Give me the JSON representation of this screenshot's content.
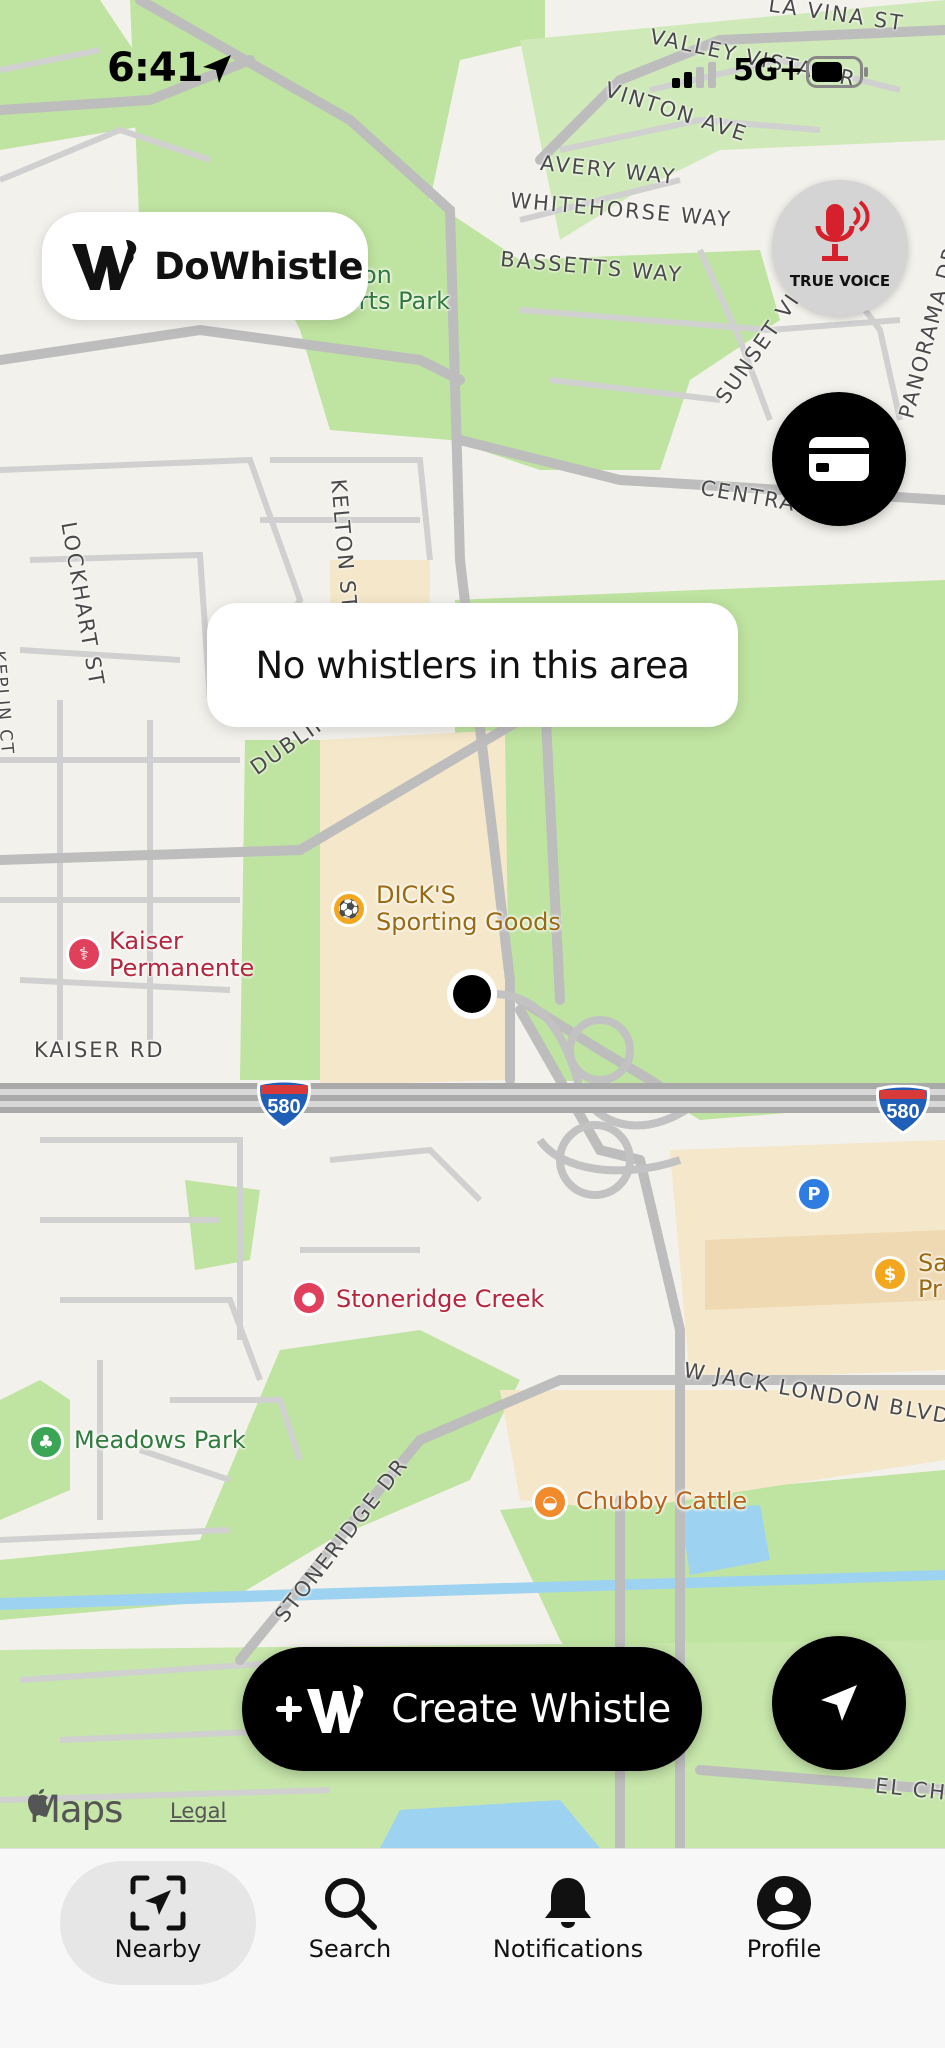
{
  "status_bar": {
    "time": "6:41",
    "network": "5G+"
  },
  "brand": {
    "name": "DoWhistle"
  },
  "true_voice": {
    "label": "TRUE VOICE"
  },
  "banner": {
    "message": "No whistlers in this area"
  },
  "create_button": {
    "label": "Create Whistle"
  },
  "map": {
    "attribution": "Maps",
    "legal": "Legal",
    "road_labels": {
      "la_vina": "LA VINA ST",
      "valley_vista": "VALLEY VISTA DR",
      "vinton": "VINTON AVE",
      "avery": "AVERY WAY",
      "whitehorse": "WHITEHORSE WAY",
      "bassetts": "BASSETTS WAY",
      "sunset": "SUNSET VIE",
      "panorama": "PANORAMA DR",
      "central": "CENTRAL",
      "lockhart": "LOCKHART ST",
      "kelton": "KELTON ST",
      "dublin": "DUBLIN BLVD",
      "kaiser_rd": "KAISER RD",
      "jack_london": "W JACK LONDON BLVD",
      "stoneridge": "STONERIDGE DR",
      "el_cha": "EL CHA",
      "left_edge": "KEPLIN CT"
    },
    "park_label": {
      "line1": "on",
      "line2": "orts Park"
    },
    "pois": {
      "dicks": "DICK'S Sporting Goods",
      "dicks_line1": "DICK'S",
      "dicks_line2": "Sporting Goods",
      "kaiser_line1": "Kaiser",
      "kaiser_line2": "Permanente",
      "stoneridge_creek": "Stoneridge Creek",
      "meadows_park": "Meadows Park",
      "chubby_cattle": "Chubby Cattle",
      "right_edge_line1": "Sa",
      "right_edge_line2": "Pr",
      "parking": "P"
    },
    "shields": {
      "left": "580",
      "right": "580"
    },
    "colors": {
      "base": "#f3f1ec",
      "green": "#bfe3a0",
      "beige": "#f5e7c9",
      "water": "#9dd3f0",
      "road": "#b8b8b8",
      "freeway": "#a9a9a9"
    }
  },
  "tabs": [
    {
      "label": "Nearby",
      "active": true
    },
    {
      "label": "Search",
      "active": false
    },
    {
      "label": "Notifications",
      "active": false
    },
    {
      "label": "Profile",
      "active": false
    }
  ]
}
